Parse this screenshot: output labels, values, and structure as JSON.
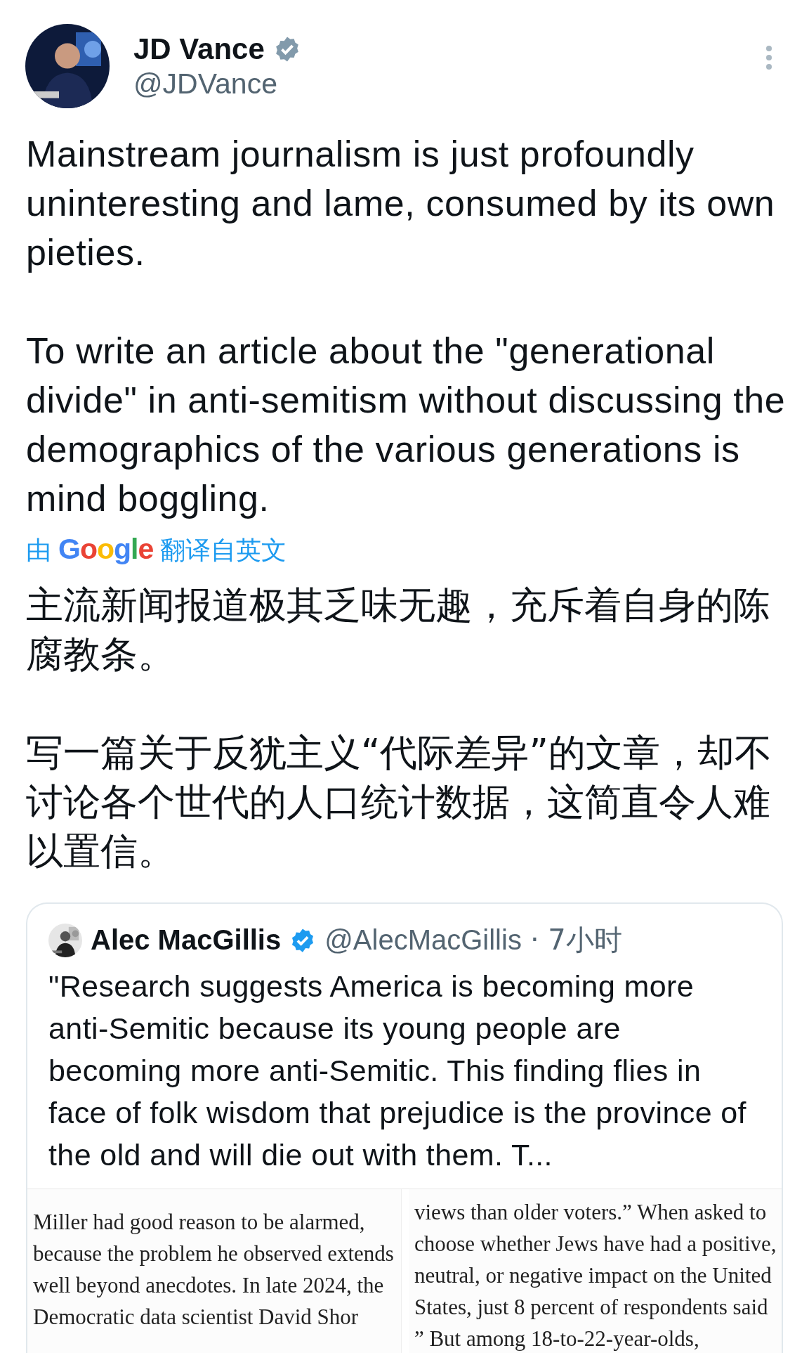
{
  "author": {
    "name": "JD Vance",
    "handle": "@JDVance",
    "badge": {
      "kind": "government"
    }
  },
  "paragraphs": [
    "Mainstream journalism is just profoundly uninteresting and lame, consumed by its own pieties.",
    "To write an article about the \"generational divide\" in anti-semitism without discussing the demographics of the various generations is mind boggling."
  ],
  "translation": {
    "prefix": "由",
    "brand": "Google",
    "suffix": "翻译自英文"
  },
  "translated_paragraphs": [
    "主流新闻报道极其乏味无趣，充斥着自身的陈腐教条。",
    "写一篇关于反犹主义“代际差异”的文章，却不讨论各个世代的人口统计数据，这简直令人难以置信。"
  ],
  "quoted": {
    "name": "Alec MacGillis",
    "handle": "@AlecMacGillis",
    "badge": {
      "kind": "standard"
    },
    "time": "· 7小时",
    "text": "\"Research suggests America is becoming more anti-Semitic because its young people are becoming more anti-Semitic. This finding flies in face of folk wisdom that prejudice is the province of the old and will die out with them. T...",
    "documents": [
      {
        "lines": [
          "Miller had good reason to be alarmed,",
          "because the problem he observed extends",
          "well beyond anecdotes. In late 2024, the",
          "Democratic data scientist David Shor"
        ]
      },
      {
        "lines": [
          "views than older voters.” When asked to",
          "choose whether Jews have had a positive,",
          "neutral, or negative impact on the United",
          "States, just 8 percent of respondents said",
          "” But among 18-to-22-year-olds,"
        ]
      }
    ]
  }
}
